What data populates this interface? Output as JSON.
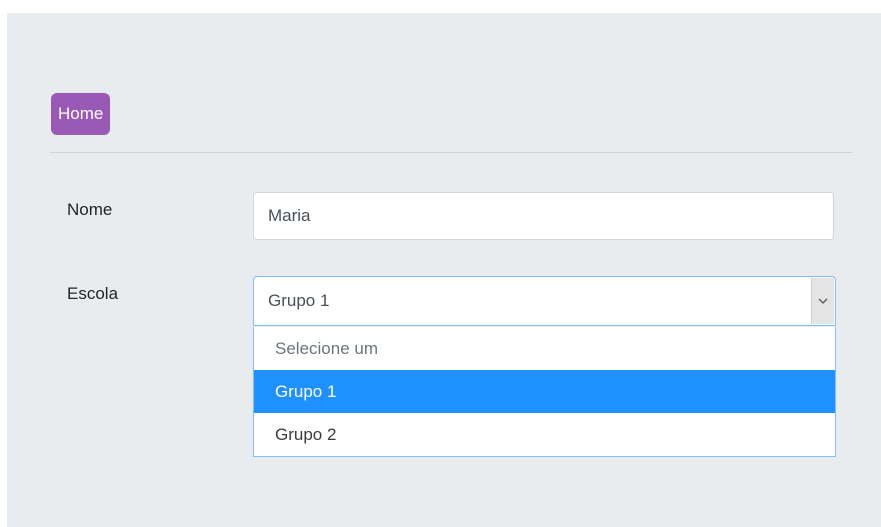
{
  "header": {
    "home_label": "Home"
  },
  "form": {
    "nome": {
      "label": "Nome",
      "value": "Maria"
    },
    "escola": {
      "label": "Escola",
      "selected": "Grupo 1",
      "options": [
        {
          "label": "Selecione um",
          "placeholder": true
        },
        {
          "label": "Grupo 1",
          "selected": true
        },
        {
          "label": "Grupo 2"
        }
      ]
    }
  },
  "icons": {
    "select_arrow": "chevron-down-icon"
  },
  "colors": {
    "home_button": "#9b59b6",
    "panel_background": "#e9ecef",
    "option_highlight": "#1e90ff",
    "focus_border": "#80bdff"
  }
}
